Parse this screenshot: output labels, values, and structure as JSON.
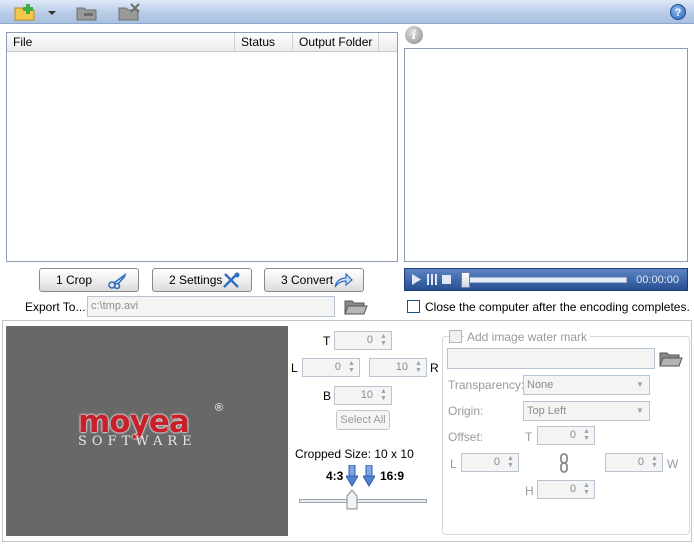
{
  "toolbar": {
    "add_icon": "add-file-icon",
    "help_label": "?"
  },
  "file_list": {
    "columns": [
      "File",
      "Status",
      "Output Folder"
    ]
  },
  "preview": {
    "info_label": "i"
  },
  "player": {
    "time": "00:00:00"
  },
  "actions": {
    "crop_label": "1 Crop",
    "settings_label": "2 Settings",
    "convert_label": "3 Convert"
  },
  "export": {
    "label": "Export To...",
    "path": "c:\\tmp.avi"
  },
  "shutdown": {
    "label": "Close the computer after the encoding completes."
  },
  "logo": {
    "brand": "moyea",
    "registered": "®",
    "sub": "SOFTWARE"
  },
  "crop": {
    "t_label": "T",
    "t_value": "0",
    "l_label": "L",
    "l_value": "0",
    "r_label": "R",
    "r_value": "10",
    "b_label": "B",
    "b_value": "10",
    "select_all_label": "Select All",
    "cropped_size_label": "Cropped Size: 10 x 10",
    "ratio_left": "4:3",
    "ratio_right": "16:9"
  },
  "watermark": {
    "checkbox_label": "Add image water mark",
    "transparency_label": "Transparency:",
    "transparency_value": "None",
    "origin_label": "Origin:",
    "origin_value": "Top Left",
    "offset_label": "Offset:",
    "t_label": "T",
    "t_value": "0",
    "l_label": "L",
    "l_value": "0",
    "w_label": "W",
    "w_value": "0",
    "h_label": "H",
    "h_value": "0"
  },
  "colors": {
    "toolbar_top": "#dfe9f7",
    "player_bg": "#274f92",
    "logo_bg": "#686868",
    "brand_red": "#c8202a"
  }
}
